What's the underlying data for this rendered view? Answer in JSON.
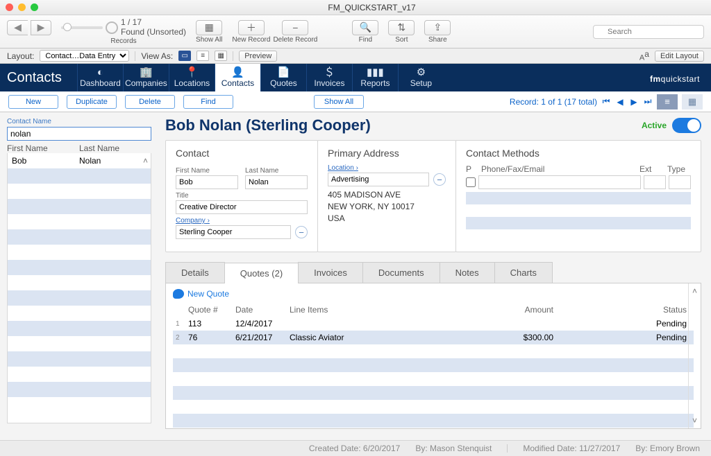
{
  "window_title": "FM_QUICKSTART_v17",
  "toolbar": {
    "records_label": "Records",
    "rec_count": "1 / 17",
    "rec_found": "Found (Unsorted)",
    "show_all": "Show All",
    "new_record": "New Record",
    "delete_record": "Delete Record",
    "find": "Find",
    "sort": "Sort",
    "share": "Share",
    "search_placeholder": "Search"
  },
  "layoutbar": {
    "layout_label": "Layout:",
    "layout_value": "Contact…Data Entry",
    "view_as": "View As:",
    "preview": "Preview",
    "edit_layout": "Edit Layout"
  },
  "nav": {
    "app": "Contacts",
    "items": [
      "Dashboard",
      "Companies",
      "Locations",
      "Contacts",
      "Quotes",
      "Invoices",
      "Reports",
      "Setup"
    ],
    "brand_prefix": "fm",
    "brand_suffix": "quickstart"
  },
  "actions": {
    "new": "New",
    "duplicate": "Duplicate",
    "delete": "Delete",
    "find": "Find",
    "show_all": "Show All",
    "record_text": "Record:  1 of 1 (17 total)"
  },
  "sidebar": {
    "label": "Contact Name",
    "search_value": "nolan",
    "first_name_h": "First Name",
    "last_name_h": "Last Name",
    "rows": [
      {
        "first": "Bob",
        "last": "Nolan"
      }
    ]
  },
  "header": {
    "title": "Bob Nolan (Sterling Cooper)",
    "active": "Active"
  },
  "contact": {
    "panel_title": "Contact",
    "first_name_l": "First Name",
    "first_name": "Bob",
    "last_name_l": "Last Name",
    "last_name": "Nolan",
    "title_l": "Title",
    "title": "Creative Director",
    "company_l": "Company",
    "company": "Sterling Cooper"
  },
  "address": {
    "panel_title": "Primary Address",
    "location_l": "Location",
    "location": "Advertising",
    "line1": "405 MADISON AVE",
    "line2": "NEW YORK, NY 10017",
    "line3": "USA"
  },
  "methods": {
    "panel_title": "Contact Methods",
    "p": "P",
    "pfe": "Phone/Fax/Email",
    "ext": "Ext",
    "type": "Type"
  },
  "tabs": {
    "details": "Details",
    "quotes": "Quotes (2)",
    "invoices": "Invoices",
    "documents": "Documents",
    "notes": "Notes",
    "charts": "Charts"
  },
  "quotes": {
    "new": "New Quote",
    "h_num": "Quote #",
    "h_date": "Date",
    "h_li": "Line Items",
    "h_amt": "Amount",
    "h_st": "Status",
    "rows": [
      {
        "n": "1",
        "q": "113",
        "d": "12/4/2017",
        "li": "",
        "amt": "",
        "st": "Pending"
      },
      {
        "n": "2",
        "q": "76",
        "d": "6/21/2017",
        "li": "Classic Aviator",
        "amt": "$300.00",
        "st": "Pending"
      }
    ]
  },
  "footer": {
    "created_l": "Created Date:",
    "created": "6/20/2017",
    "by1_l": "By:",
    "by1": "Mason Stenquist",
    "modified_l": "Modified Date:",
    "modified": "11/27/2017",
    "by2_l": "By:",
    "by2": "Emory Brown"
  }
}
